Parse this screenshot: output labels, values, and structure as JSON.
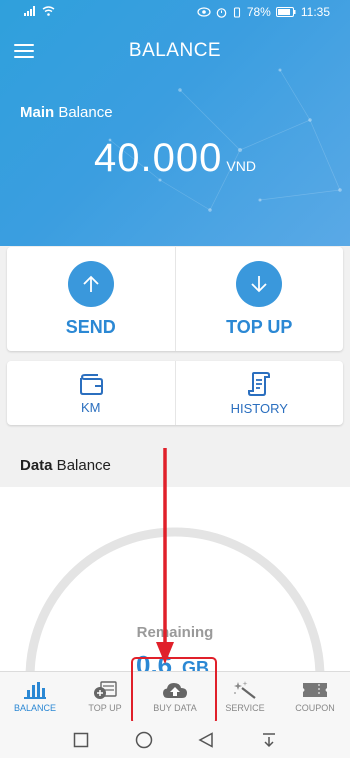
{
  "status": {
    "battery": "78%",
    "time": "11:35"
  },
  "header": {
    "title": "BALANCE"
  },
  "main_balance": {
    "label_bold": "Main",
    "label_rest": " Balance",
    "amount": "40.000",
    "currency": "VND"
  },
  "actions": [
    {
      "label": "SEND",
      "icon": "arrow-up-icon"
    },
    {
      "label": "TOP UP",
      "icon": "arrow-down-icon"
    }
  ],
  "shortcuts": [
    {
      "label": "KM",
      "icon": "wallet-icon"
    },
    {
      "label": "HISTORY",
      "icon": "scroll-icon"
    }
  ],
  "data_balance": {
    "label_bold": "Data",
    "label_rest": " Balance",
    "remaining_label": "Remaining"
  },
  "tabs": [
    {
      "label": "BALANCE",
      "icon": "bar-chart-icon",
      "active": true
    },
    {
      "label": "TOP UP",
      "icon": "card-plus-icon",
      "active": false
    },
    {
      "label": "BUY DATA",
      "icon": "cloud-upload-icon",
      "active": false
    },
    {
      "label": "SERVICE",
      "icon": "magic-wand-icon",
      "active": false
    },
    {
      "label": "COUPON",
      "icon": "ticket-icon",
      "active": false
    }
  ],
  "colors": {
    "primary": "#3a98dc",
    "annotation": "#e0202a"
  }
}
